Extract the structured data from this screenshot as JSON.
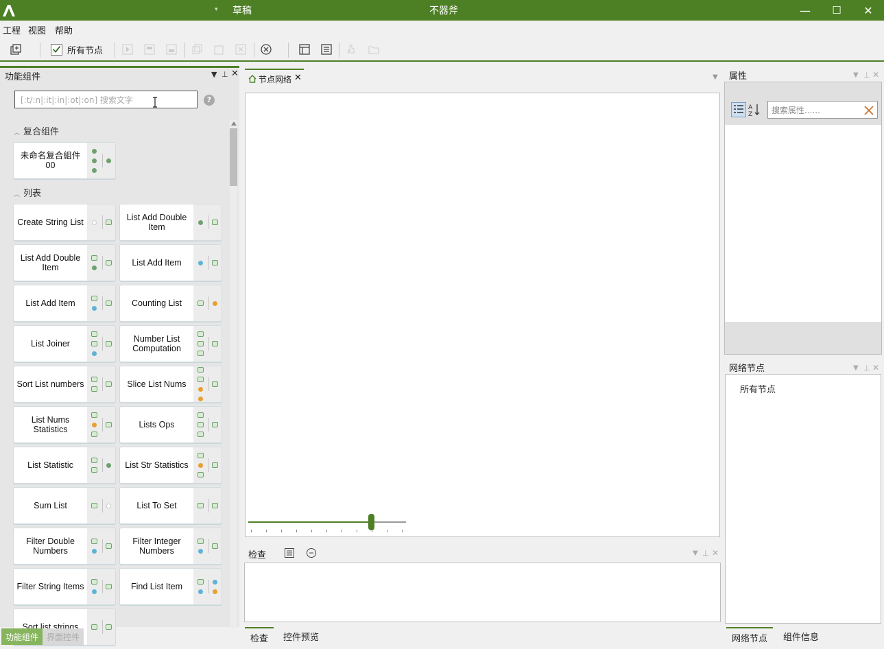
{
  "window": {
    "document_title": "草稿",
    "app_title": "不器斧",
    "dropdown_glyph": "▾",
    "minimize": "—",
    "maximize": "☐",
    "close": "✕"
  },
  "menu": {
    "items": [
      "工程",
      "视图",
      "帮助"
    ]
  },
  "toolbar": {
    "show_all_nodes_label": "所有节点",
    "show_all_nodes_checked": true
  },
  "left_panel": {
    "title": "功能组件",
    "search_placeholder": "[:t/:n|:it|:in|:ot|:on] 搜索文字",
    "help": "?",
    "sections": [
      {
        "title": "复合组件",
        "items": [
          {
            "label": "未命名复合組件00"
          }
        ]
      },
      {
        "title": "列表",
        "items": [
          {
            "label": "Create String List"
          },
          {
            "label": "List Add Double Item"
          },
          {
            "label": "List Add Double Item"
          },
          {
            "label": "List Add Item"
          },
          {
            "label": "List Add Item"
          },
          {
            "label": "Counting List"
          },
          {
            "label": "List Joiner"
          },
          {
            "label": "Number List Computation"
          },
          {
            "label": "Sort List numbers"
          },
          {
            "label": "Slice List Nums"
          },
          {
            "label": "List Nums Statistics"
          },
          {
            "label": "Lists Ops"
          },
          {
            "label": "List Statistic"
          },
          {
            "label": "List Str Statistics"
          },
          {
            "label": "Sum List"
          },
          {
            "label": "List To Set"
          },
          {
            "label": "Filter Double Numbers"
          },
          {
            "label": "Filter Integer Numbers"
          },
          {
            "label": "Filter String Items"
          },
          {
            "label": "Find List Item"
          },
          {
            "label": "Sort list strings"
          }
        ]
      }
    ],
    "bottom_tabs": [
      "功能组件",
      "界面控件"
    ]
  },
  "center": {
    "tab_label": "节点网络",
    "zoom_percent": 78,
    "inspector_title": "检查",
    "bottom_tabs": [
      "检查",
      "控件预览"
    ]
  },
  "right": {
    "properties_title": "属性",
    "properties_search_placeholder": "搜索属性......",
    "network_title": "网络节点",
    "network_items": [
      "所有节点"
    ],
    "bottom_tabs": [
      "网络节点",
      "组件信息"
    ]
  },
  "colors": {
    "accent": "#4d8024",
    "port_green": "#6fa06f",
    "port_blue": "#5fb3d6",
    "port_orange": "#e8a030"
  }
}
